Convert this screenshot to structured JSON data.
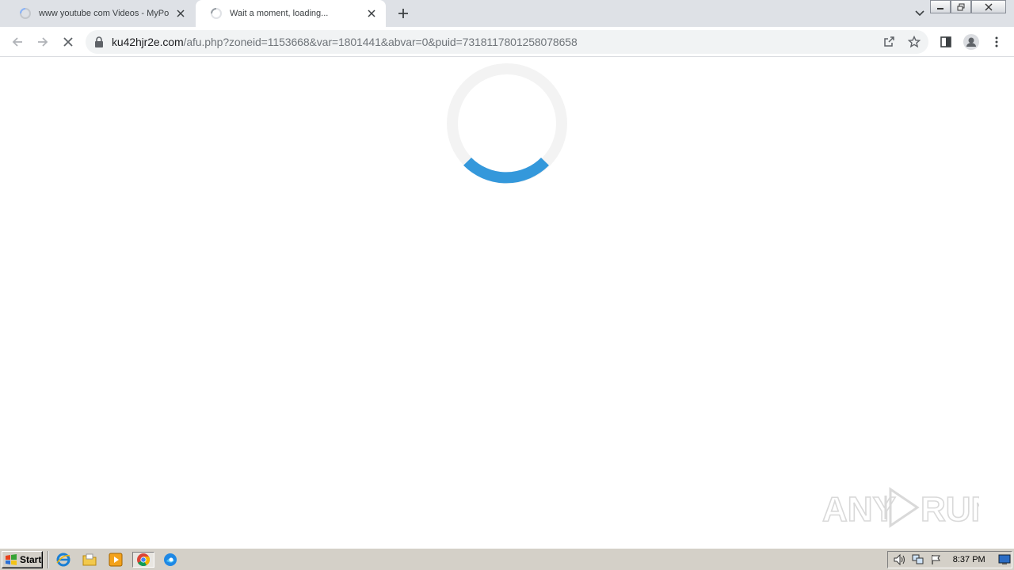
{
  "browser": {
    "tabs": [
      {
        "title": "www youtube com Videos - MyPornV",
        "active": false
      },
      {
        "title": "Wait a moment, loading...",
        "active": true
      }
    ],
    "address": {
      "host": "ku42hjr2e.com",
      "path": "/afu.php?zoneid=1153668&var=1801441&abvar=0&puid=7318117801258078658"
    }
  },
  "icons": {
    "back": "arrow-left-icon",
    "forward": "arrow-right-icon",
    "stop": "close-icon",
    "lock": "lock-icon",
    "share": "share-icon",
    "bookmark": "star-icon",
    "sidepanel": "side-panel-icon",
    "profile": "profile-icon",
    "menu": "kebab-menu-icon"
  },
  "page": {
    "loader_color": "#3498db",
    "loader_track_color": "#f3f3f3"
  },
  "watermark": {
    "text_left": "ANY",
    "text_right": "RUN"
  },
  "taskbar": {
    "start_label": "Start",
    "clock": "8:37 PM"
  }
}
